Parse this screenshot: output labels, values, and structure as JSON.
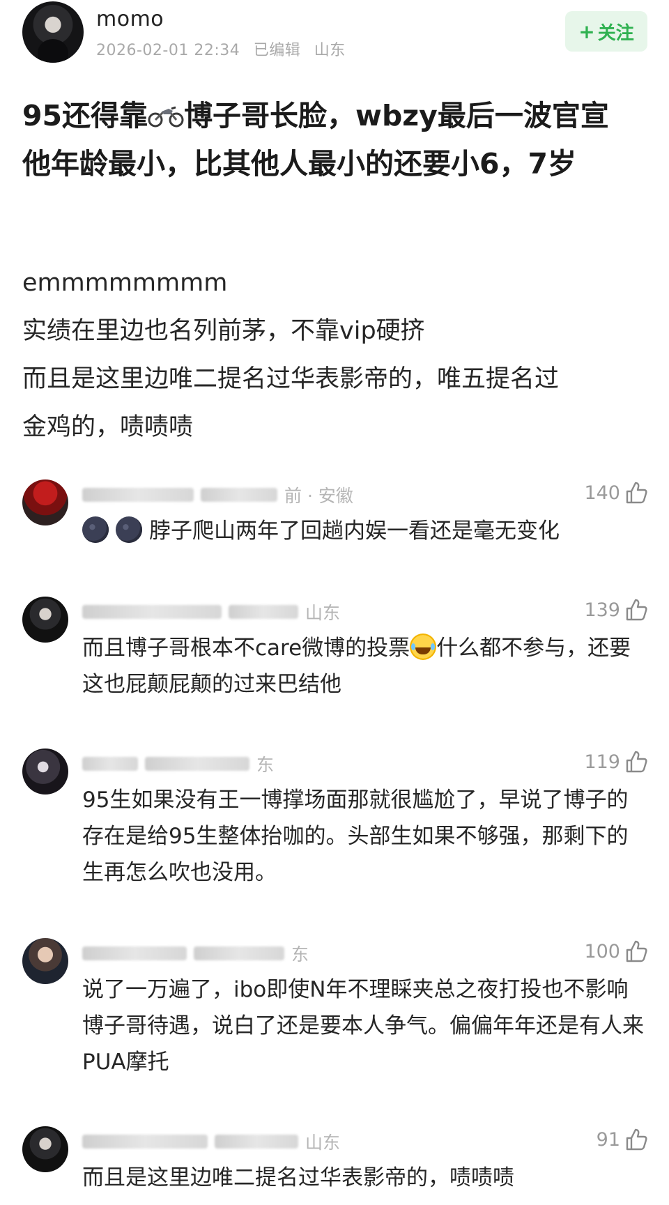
{
  "post": {
    "author": "momo",
    "datetime": "2026-02-01 22:34",
    "edited": "已编辑",
    "location": "山东",
    "follow_label": "关注",
    "follow_plus": "+",
    "title_part1": "95还得靠",
    "title_part2": "博子哥长脸，wbzy最后一波官宣他年龄最小，比其他人最小的还要小6，7岁",
    "title_icon": "motorcycle-emoji",
    "body_lines": [
      "emmmmmmmm",
      "实绩在里边也名列前茅，不靠vip硬挤",
      "而且是这里边唯二提名过华表影帝的，唯五提名过",
      "金鸡的，啧啧啧"
    ]
  },
  "comments": [
    {
      "meta_visible": "前 · 安徽",
      "likes": "140",
      "text": "脖子爬山两年了回趟内娱一看还是毫无变化",
      "emojis": [
        "new-moon-face-emoji",
        "new-moon-face-emoji"
      ]
    },
    {
      "meta_visible": "山东",
      "likes": "139",
      "text_before": "而且博子哥根本不care微博的投票",
      "text_after": "什么都不参与，还要这也屁颠屁颠的过来巴结他",
      "emoji": "laugh-cry-emoji"
    },
    {
      "meta_visible": "东",
      "likes": "119",
      "text": "95生如果没有王一博撑场面那就很尴尬了，早说了博子的存在是给95生整体抬咖的。头部生如果不够强，那剩下的生再怎么吹也没用。"
    },
    {
      "meta_visible": "东",
      "likes": "100",
      "text": "说了一万遍了，ibo即使N年不理睬夹总之夜打投也不影响博子哥待遇，说白了还是要本人争气。偏偏年年还是有人来PUA摩托"
    },
    {
      "meta_visible": "山东",
      "likes": "91",
      "text": "而且是这里边唯二提名过华表影帝的，啧啧啧"
    }
  ],
  "colors": {
    "follow_bg": "#e7f6ea",
    "follow_text": "#2fb150",
    "meta_gray": "#a9a9a9",
    "like_gray": "#9a9a9a"
  }
}
